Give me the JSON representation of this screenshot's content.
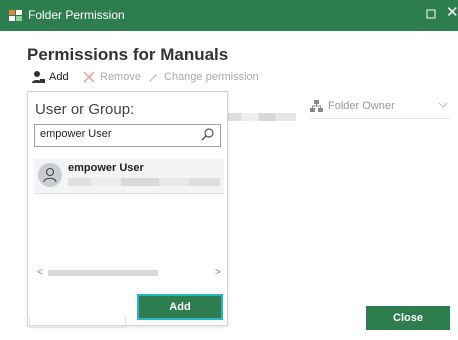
{
  "window": {
    "title": "Folder Permission",
    "maximize_icon": "square-icon",
    "close_symbol": "✕"
  },
  "heading": "Permissions for Manuals",
  "toolbar": {
    "add_label": "Add",
    "remove_label": "Remove",
    "change_label": "Change permission"
  },
  "owner": {
    "label": "Folder Owner"
  },
  "picker": {
    "label": "User or Group:",
    "search_value": "empower User",
    "result_name": "empower User",
    "add_label": "Add"
  },
  "footer": {
    "close_label": "Close"
  },
  "colors": {
    "accent": "#2e7d4f",
    "focus_ring": "#2bb5c9"
  }
}
